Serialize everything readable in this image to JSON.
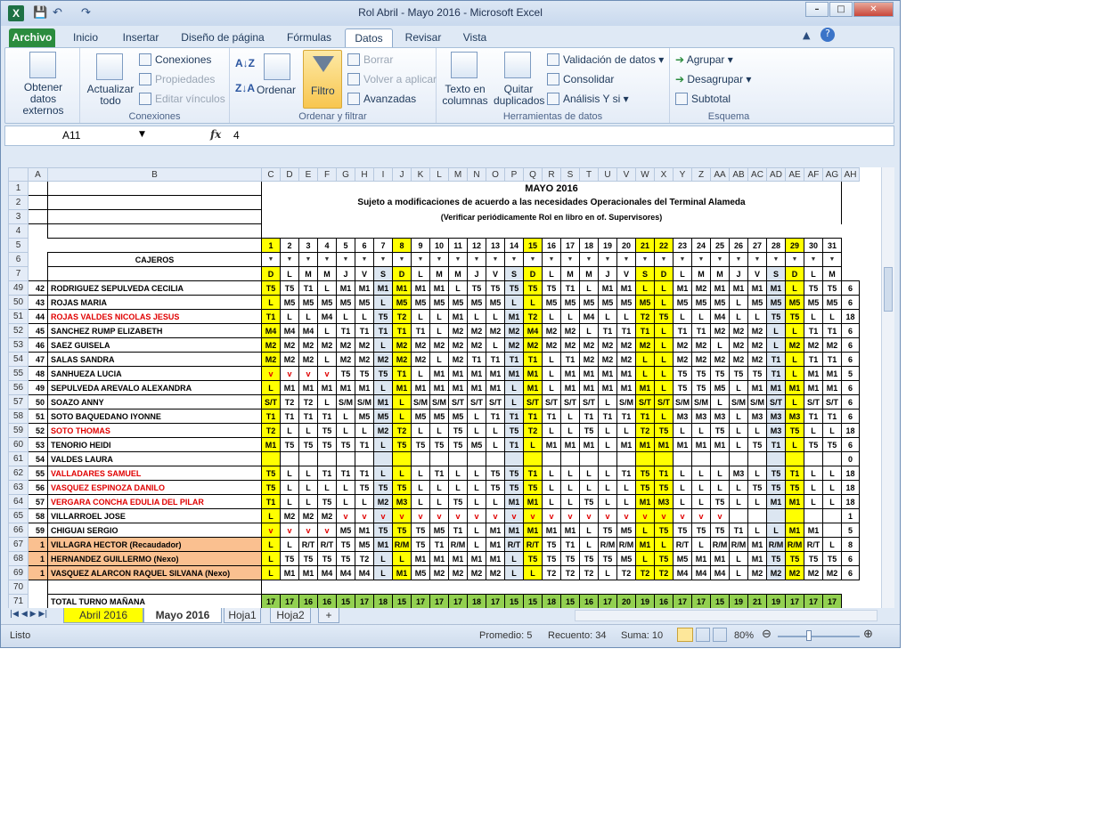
{
  "window": {
    "title": "Rol Abril - Mayo 2016  -  Microsoft Excel"
  },
  "tabs": [
    "Archivo",
    "Inicio",
    "Insertar",
    "Diseño de página",
    "Fórmulas",
    "Datos",
    "Revisar",
    "Vista"
  ],
  "ribbon": {
    "obtener": "Obtener datos externos",
    "actualizar": "Actualizar todo",
    "conexiones": "Conexiones",
    "propiedades": "Propiedades",
    "editar_vinculos": "Editar vínculos",
    "grp_conexiones": "Conexiones",
    "ordenar": "Ordenar",
    "filtro": "Filtro",
    "borrar": "Borrar",
    "volver": "Volver a aplicar",
    "avanzadas": "Avanzadas",
    "grp_ordenar": "Ordenar y filtrar",
    "texto_col": "Texto en columnas",
    "quitar_dup": "Quitar duplicados",
    "validacion": "Validación de datos",
    "consolidar": "Consolidar",
    "analisis": "Análisis Y si",
    "grp_herr": "Herramientas de datos",
    "agrupar": "Agrupar",
    "desagrupar": "Desagrupar",
    "subtotal": "Subtotal",
    "grp_esquema": "Esquema"
  },
  "formula_bar": {
    "name": "A11",
    "fx": "fx",
    "value": "4"
  },
  "sheet": {
    "title": "MAYO    2016",
    "subtitle": "Sujeto a modificaciones de acuerdo a las necesidades Operacionales del Terminal Alameda",
    "note": "(Verificar periódicamente Rol en libro en of. Supervisores)",
    "cajeros": "CAJEROS",
    "days": [
      "1",
      "2",
      "3",
      "4",
      "5",
      "6",
      "7",
      "8",
      "9",
      "10",
      "11",
      "12",
      "13",
      "14",
      "15",
      "16",
      "17",
      "18",
      "19",
      "20",
      "21",
      "22",
      "23",
      "24",
      "25",
      "26",
      "27",
      "28",
      "29",
      "30",
      "31"
    ],
    "weekdays": [
      "D",
      "L",
      "M",
      "M",
      "J",
      "V",
      "S",
      "D",
      "L",
      "M",
      "M",
      "J",
      "V",
      "S",
      "D",
      "L",
      "M",
      "M",
      "J",
      "V",
      "S",
      "D",
      "L",
      "M",
      "M",
      "J",
      "V",
      "S",
      "D",
      "L",
      "M"
    ],
    "rows": [
      {
        "r": "49",
        "n": "42",
        "name": "RODRIGUEZ SEPULVEDA CECILIA",
        "red": false,
        "shifts": [
          "T5",
          "T5",
          "T1",
          "L",
          "M1",
          "M1",
          "M1",
          "M1",
          "M1",
          "M1",
          "L",
          "T5",
          "T5",
          "T5",
          "T5",
          "T5",
          "T1",
          "L",
          "M1",
          "M1",
          "L",
          "L",
          "M1",
          "M2",
          "M1",
          "M1",
          "M1",
          "M1",
          "L",
          "T5",
          "T5"
        ],
        "total": "6"
      },
      {
        "r": "50",
        "n": "43",
        "name": "ROJAS MARIA",
        "red": false,
        "shifts": [
          "L",
          "M5",
          "M5",
          "M5",
          "M5",
          "M5",
          "L",
          "M5",
          "M5",
          "M5",
          "M5",
          "M5",
          "M5",
          "L",
          "L",
          "M5",
          "M5",
          "M5",
          "M5",
          "M5",
          "M5",
          "L",
          "M5",
          "M5",
          "M5",
          "L",
          "M5",
          "M5",
          "M5",
          "M5",
          "M5"
        ],
        "total": "6"
      },
      {
        "r": "51",
        "n": "44",
        "name": "ROJAS VALDES NICOLAS JESUS",
        "red": true,
        "shifts": [
          "T1",
          "L",
          "L",
          "M4",
          "L",
          "L",
          "T5",
          "T2",
          "L",
          "L",
          "M1",
          "L",
          "L",
          "M1",
          "T2",
          "L",
          "L",
          "M4",
          "L",
          "L",
          "T2",
          "T5",
          "L",
          "L",
          "M4",
          "L",
          "L",
          "T5",
          "T5",
          "L",
          "L"
        ],
        "total": "18"
      },
      {
        "r": "52",
        "n": "45",
        "name": "SANCHEZ RUMP ELIZABETH",
        "red": false,
        "shifts": [
          "M4",
          "M4",
          "M4",
          "L",
          "T1",
          "T1",
          "T1",
          "T1",
          "T1",
          "L",
          "M2",
          "M2",
          "M2",
          "M2",
          "M4",
          "M2",
          "M2",
          "L",
          "T1",
          "T1",
          "T1",
          "L",
          "T1",
          "T1",
          "M2",
          "M2",
          "M2",
          "L",
          "L",
          "T1",
          "T1"
        ],
        "total": "6"
      },
      {
        "r": "53",
        "n": "46",
        "name": "SAEZ GUISELA",
        "red": false,
        "shifts": [
          "M2",
          "M2",
          "M2",
          "M2",
          "M2",
          "M2",
          "L",
          "M2",
          "M2",
          "M2",
          "M2",
          "M2",
          "L",
          "M2",
          "M2",
          "M2",
          "M2",
          "M2",
          "M2",
          "M2",
          "M2",
          "L",
          "M2",
          "M2",
          "L",
          "M2",
          "M2",
          "L",
          "M2",
          "M2",
          "M2"
        ],
        "total": "6"
      },
      {
        "r": "54",
        "n": "47",
        "name": "SALAS SANDRA",
        "red": false,
        "shifts": [
          "M2",
          "M2",
          "M2",
          "L",
          "M2",
          "M2",
          "M2",
          "M2",
          "M2",
          "L",
          "M2",
          "T1",
          "T1",
          "T1",
          "T1",
          "L",
          "T1",
          "M2",
          "M2",
          "M2",
          "L",
          "L",
          "M2",
          "M2",
          "M2",
          "M2",
          "M2",
          "T1",
          "L",
          "T1",
          "T1"
        ],
        "total": "6"
      },
      {
        "r": "55",
        "n": "48",
        "name": "SANHUEZA LUCIA",
        "red": false,
        "shifts": [
          "v",
          "v",
          "v",
          "v",
          "T5",
          "T5",
          "T5",
          "T1",
          "L",
          "M1",
          "M1",
          "M1",
          "M1",
          "M1",
          "M1",
          "L",
          "M1",
          "M1",
          "M1",
          "M1",
          "L",
          "L",
          "T5",
          "T5",
          "T5",
          "T5",
          "T5",
          "T1",
          "L",
          "M1",
          "M1"
        ],
        "total": "5"
      },
      {
        "r": "56",
        "n": "49",
        "name": "SEPULVEDA AREVALO ALEXANDRA",
        "red": false,
        "shifts": [
          "L",
          "M1",
          "M1",
          "M1",
          "M1",
          "M1",
          "L",
          "M1",
          "M1",
          "M1",
          "M1",
          "M1",
          "M1",
          "L",
          "M1",
          "L",
          "M1",
          "M1",
          "M1",
          "M1",
          "M1",
          "L",
          "T5",
          "T5",
          "M5",
          "L",
          "M1",
          "M1",
          "M1",
          "M1",
          "M1"
        ],
        "total": "6"
      },
      {
        "r": "57",
        "n": "50",
        "name": "SOAZO ANNY",
        "red": false,
        "shifts": [
          "S/T",
          "T2",
          "T2",
          "L",
          "S/M",
          "S/M",
          "M1",
          "L",
          "S/M",
          "S/M",
          "S/T",
          "S/T",
          "S/T",
          "L",
          "S/T",
          "S/T",
          "S/T",
          "S/T",
          "L",
          "S/M",
          "S/T",
          "S/T",
          "S/M",
          "S/M",
          "L",
          "S/M",
          "S/M",
          "S/T",
          "L",
          "S/T",
          "S/T"
        ],
        "total": "6"
      },
      {
        "r": "58",
        "n": "51",
        "name": "SOTO BAQUEDANO IYONNE",
        "red": false,
        "shifts": [
          "T1",
          "T1",
          "T1",
          "T1",
          "L",
          "M5",
          "M5",
          "L",
          "M5",
          "M5",
          "M5",
          "L",
          "T1",
          "T1",
          "T1",
          "T1",
          "L",
          "T1",
          "T1",
          "T1",
          "T1",
          "L",
          "M3",
          "M3",
          "M3",
          "L",
          "M3",
          "M3",
          "M3",
          "T1",
          "T1"
        ],
        "total": "6"
      },
      {
        "r": "59",
        "n": "52",
        "name": "SOTO THOMAS",
        "red": true,
        "shifts": [
          "T2",
          "L",
          "L",
          "T5",
          "L",
          "L",
          "M2",
          "T2",
          "L",
          "L",
          "T5",
          "L",
          "L",
          "T5",
          "T2",
          "L",
          "L",
          "T5",
          "L",
          "L",
          "T2",
          "T5",
          "L",
          "L",
          "T5",
          "L",
          "L",
          "M3",
          "T5",
          "L",
          "L"
        ],
        "total": "18"
      },
      {
        "r": "60",
        "n": "53",
        "name": "TENORIO HEIDI",
        "red": false,
        "shifts": [
          "M1",
          "T5",
          "T5",
          "T5",
          "T5",
          "T1",
          "L",
          "T5",
          "T5",
          "T5",
          "T5",
          "M5",
          "L",
          "T1",
          "L",
          "M1",
          "M1",
          "M1",
          "L",
          "M1",
          "M1",
          "M1",
          "M1",
          "M1",
          "M1",
          "L",
          "T5",
          "T1",
          "L",
          "T5",
          "T5"
        ],
        "total": "6"
      },
      {
        "r": "61",
        "n": "54",
        "name": "VALDES LAURA",
        "red": false,
        "shifts": [
          "",
          "",
          "",
          "",
          "",
          "",
          "",
          "",
          "",
          "",
          "",
          "",
          "",
          "",
          "",
          "",
          "",
          "",
          "",
          "",
          "",
          "",
          "",
          "",
          "",
          "",
          "",
          "",
          "",
          "",
          ""
        ],
        "total": "0"
      },
      {
        "r": "62",
        "n": "55",
        "name": "VALLADARES SAMUEL",
        "red": true,
        "shifts": [
          "T5",
          "L",
          "L",
          "T1",
          "T1",
          "T1",
          "L",
          "L",
          "L",
          "T1",
          "L",
          "L",
          "T5",
          "T5",
          "T1",
          "L",
          "L",
          "L",
          "L",
          "T1",
          "T5",
          "T1",
          "L",
          "L",
          "L",
          "M3",
          "L",
          "T5",
          "T1",
          "L",
          "L"
        ],
        "total": "18"
      },
      {
        "r": "63",
        "n": "56",
        "name": "VASQUEZ ESPINOZA DANILO",
        "red": true,
        "shifts": [
          "T5",
          "L",
          "L",
          "L",
          "L",
          "T5",
          "T5",
          "T5",
          "L",
          "L",
          "L",
          "L",
          "T5",
          "T5",
          "T5",
          "L",
          "L",
          "L",
          "L",
          "L",
          "T5",
          "T5",
          "L",
          "L",
          "L",
          "L",
          "T5",
          "T5",
          "T5",
          "L",
          "L"
        ],
        "total": "18"
      },
      {
        "r": "64",
        "n": "57",
        "name": "VERGARA CONCHA EDULIA DEL PILAR",
        "red": true,
        "shifts": [
          "T1",
          "L",
          "L",
          "T5",
          "L",
          "L",
          "M2",
          "M3",
          "L",
          "L",
          "T5",
          "L",
          "L",
          "M1",
          "M1",
          "L",
          "L",
          "T5",
          "L",
          "L",
          "M1",
          "M3",
          "L",
          "L",
          "T5",
          "L",
          "L",
          "M1",
          "M1",
          "L",
          "L"
        ],
        "total": "18"
      },
      {
        "r": "65",
        "n": "58",
        "name": "VILLARROEL JOSE",
        "red": false,
        "shifts": [
          "L",
          "M2",
          "M2",
          "M2",
          "v",
          "v",
          "v",
          "v",
          "v",
          "v",
          "v",
          "v",
          "v",
          "v",
          "v",
          "v",
          "v",
          "v",
          "v",
          "v",
          "v",
          "v",
          "v",
          "v",
          "v",
          "",
          "",
          "",
          "",
          "",
          ""
        ],
        "total": "1"
      },
      {
        "r": "66",
        "n": "59",
        "name": "CHIGUAI SERGIO",
        "red": false,
        "shifts": [
          "v",
          "v",
          "v",
          "v",
          "M5",
          "M1",
          "T5",
          "T5",
          "T5",
          "M5",
          "T1",
          "L",
          "M1",
          "M1",
          "M1",
          "M1",
          "M1",
          "L",
          "T5",
          "M5",
          "L",
          "T5",
          "T5",
          "T5",
          "T5",
          "T1",
          "L",
          "L",
          "M1",
          "M1",
          ""
        ],
        "total": "5"
      },
      {
        "r": "67",
        "n": "1",
        "name": "VILLAGRA HECTOR (Recaudador)",
        "red": false,
        "orange": true,
        "shifts": [
          "L",
          "L",
          "R/T",
          "R/T",
          "T5",
          "M5",
          "M1",
          "R/M",
          "T5",
          "T1",
          "R/M",
          "L",
          "M1",
          "R/T",
          "R/T",
          "T5",
          "T1",
          "L",
          "R/M",
          "R/M",
          "M1",
          "L",
          "R/T",
          "L",
          "R/M",
          "R/M",
          "M1",
          "R/M",
          "R/M",
          "R/T",
          "L"
        ],
        "total": "8"
      },
      {
        "r": "68",
        "n": "1",
        "name": "HERNANDEZ GUILLERMO (Nexo)",
        "red": false,
        "orange": true,
        "shifts": [
          "L",
          "T5",
          "T5",
          "T5",
          "T5",
          "T2",
          "L",
          "L",
          "M1",
          "M1",
          "M1",
          "M1",
          "M1",
          "L",
          "T5",
          "T5",
          "T5",
          "T5",
          "T5",
          "M5",
          "L",
          "T5",
          "M5",
          "M1",
          "M1",
          "L",
          "M1",
          "T5",
          "T5",
          "T5",
          "T5"
        ],
        "total": "6"
      },
      {
        "r": "69",
        "n": "1",
        "name": "VASQUEZ ALARCON RAQUEL SILVANA (Nexo)",
        "red": false,
        "orange": true,
        "shifts": [
          "L",
          "M1",
          "M1",
          "M4",
          "M4",
          "M4",
          "L",
          "M1",
          "M5",
          "M2",
          "M2",
          "M2",
          "M2",
          "L",
          "L",
          "T2",
          "T2",
          "T2",
          "L",
          "T2",
          "T2",
          "T2",
          "M4",
          "M4",
          "M4",
          "L",
          "M2",
          "M2",
          "M2",
          "M2",
          "M2"
        ],
        "total": "6"
      }
    ],
    "total_label": "TOTAL TURNO MAÑANA",
    "total_values": [
      "17",
      "17",
      "16",
      "16",
      "15",
      "17",
      "18",
      "15",
      "17",
      "17",
      "17",
      "18",
      "17",
      "15",
      "15",
      "18",
      "15",
      "16",
      "17",
      "20",
      "19",
      "16",
      "17",
      "17",
      "15",
      "19",
      "21",
      "19",
      "17",
      "17",
      "17"
    ]
  },
  "sheet_tabs": [
    "Abril 2016",
    "Mayo 2016",
    "Hoja1",
    "Hoja2"
  ],
  "status": {
    "ready": "Listo",
    "promedio": "Promedio: 5",
    "recuento": "Recuento: 34",
    "suma": "Suma: 10",
    "zoom": "80%"
  },
  "colors": {
    "file_tab": "#2b8c3e",
    "highlight": "#ffff00",
    "weekend": "#dce6f1",
    "orange": "#fac090",
    "total": "#92d050"
  }
}
